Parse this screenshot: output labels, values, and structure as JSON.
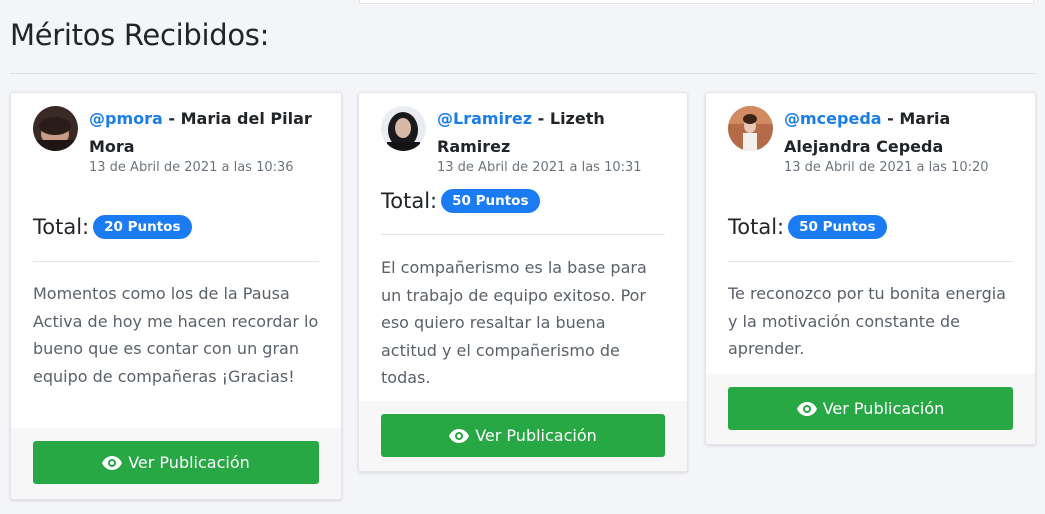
{
  "page": {
    "title": "Méritos Recibidos:"
  },
  "colors": {
    "accent": "#1a7bf2",
    "handle": "#1b7ee8",
    "button": "#28a745"
  },
  "cards": [
    {
      "handle": "@pmora",
      "separator": " - ",
      "name": "Maria del Pilar Mora",
      "date": "13 de Abril de 2021 a las 10:36",
      "total_label": "Total:",
      "points": "20 Puntos",
      "message": "Momentos como los de la Pausa Activa de hoy me hacen recordar lo bueno que es contar con un gran equipo de compañeras ¡Gracias!",
      "button_label": "Ver Publicación",
      "button_icon": "eye-icon"
    },
    {
      "handle": "@Lramirez",
      "separator": " - ",
      "name": "Lizeth Ramirez",
      "date": "13 de Abril de 2021 a las 10:31",
      "total_label": "Total:",
      "points": "50 Puntos",
      "message": "El compañerismo es la base para un trabajo de equipo exitoso. Por eso quiero resaltar la buena actitud y el compañerismo de todas.",
      "button_label": "Ver Publicación",
      "button_icon": "eye-icon"
    },
    {
      "handle": "@mcepeda",
      "separator": " - ",
      "name": "Maria Alejandra Cepeda",
      "date": "13 de Abril de 2021 a las 10:20",
      "total_label": "Total:",
      "points": "50 Puntos",
      "message": "Te reconozco por tu bonita energia y la motivación constante de aprender.",
      "button_label": "Ver Publicación",
      "button_icon": "eye-icon"
    }
  ]
}
